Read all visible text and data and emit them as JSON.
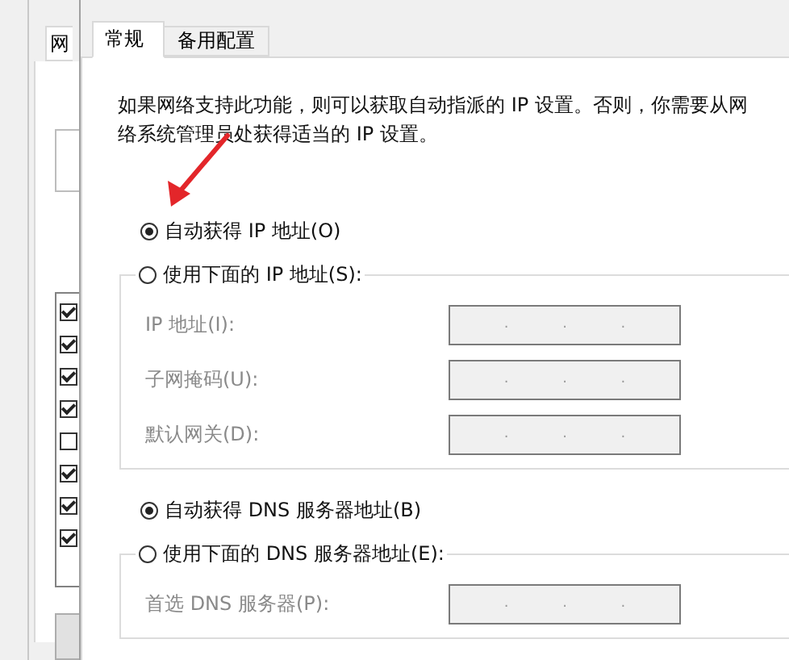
{
  "back_window": {
    "tab": "网",
    "list_items": [
      {
        "checked": true
      },
      {
        "checked": true
      },
      {
        "checked": true
      },
      {
        "checked": true
      },
      {
        "checked": false
      },
      {
        "checked": true
      },
      {
        "checked": true
      },
      {
        "checked": true
      }
    ]
  },
  "tabs": [
    {
      "label": "常规",
      "selected": true
    },
    {
      "label": "备用配置",
      "selected": false
    }
  ],
  "description": "如果网络支持此功能，则可以获取自动指派的 IP 设置。否则，你需要从网络系统管理员处获得适当的 IP 设置。",
  "ip_mode": [
    {
      "label": "自动获得 IP 地址(O)",
      "selected": true
    },
    {
      "label": "使用下面的 IP 地址(S):",
      "selected": false
    }
  ],
  "ip_fields": [
    {
      "label": "IP 地址(I):",
      "disabled": true,
      "dots": [
        ".",
        ".",
        "."
      ]
    },
    {
      "label": "子网掩码(U):",
      "disabled": true,
      "dots": [
        ".",
        ".",
        "."
      ]
    },
    {
      "label": "默认网关(D):",
      "disabled": true,
      "dots": [
        ".",
        ".",
        "."
      ]
    }
  ],
  "dns_mode": [
    {
      "label": "自动获得 DNS 服务器地址(B)",
      "selected": true
    },
    {
      "label": "使用下面的 DNS 服务器地址(E):",
      "selected": false
    }
  ],
  "dns_fields": [
    {
      "label": "首选 DNS 服务器(P):",
      "disabled": true,
      "dots": [
        ".",
        ".",
        "."
      ]
    }
  ]
}
